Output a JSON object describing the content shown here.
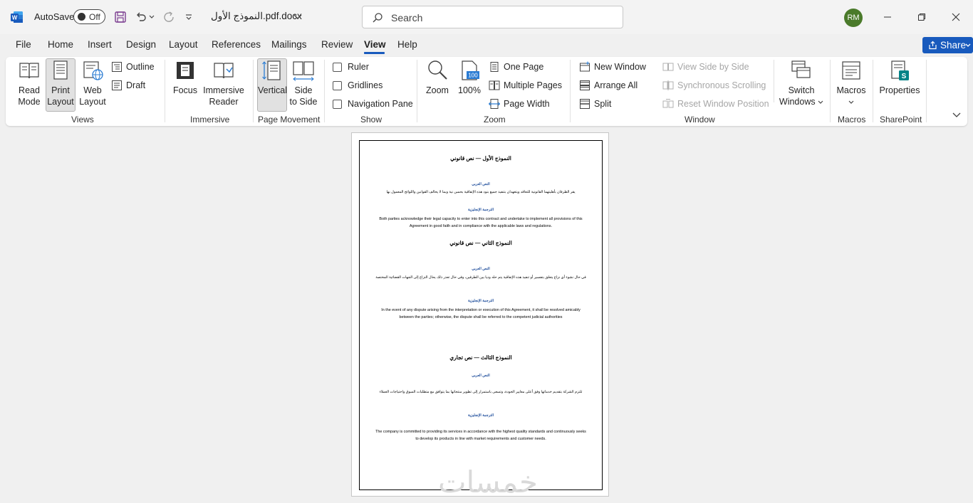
{
  "app": {
    "autosave_label": "AutoSave",
    "autosave_state": "Off",
    "doc_title": "النموذج الأول.pdf.docx",
    "search_placeholder": "Search",
    "user_initials": "RM",
    "accent": "#185abd"
  },
  "menu": {
    "tabs": [
      "File",
      "Home",
      "Insert",
      "Design",
      "Layout",
      "References",
      "Mailings",
      "Review",
      "View",
      "Help"
    ],
    "active_tab": "View",
    "share_label": "Share"
  },
  "ribbon": {
    "views": {
      "label": "Views",
      "read_mode": [
        "Read",
        "Mode"
      ],
      "print_layout": [
        "Print",
        "Layout"
      ],
      "web_layout": [
        "Web",
        "Layout"
      ],
      "outline": "Outline",
      "draft": "Draft"
    },
    "immersive": {
      "label": "Immersive",
      "focus": "Focus",
      "immersive_reader": [
        "Immersive",
        "Reader"
      ]
    },
    "page_movement": {
      "label": "Page Movement",
      "vertical": "Vertical",
      "side_to_side": [
        "Side",
        "to Side"
      ]
    },
    "show": {
      "label": "Show",
      "ruler": "Ruler",
      "gridlines": "Gridlines",
      "navigation_pane": "Navigation Pane"
    },
    "zoom": {
      "label": "Zoom",
      "zoom": "Zoom",
      "hundred": "100%",
      "hundred_icon_text": "100",
      "one_page": "One Page",
      "multiple_pages": "Multiple Pages",
      "page_width": "Page Width"
    },
    "window": {
      "label": "Window",
      "new_window": "New Window",
      "arrange_all": "Arrange All",
      "split": "Split",
      "view_side_by_side": "View Side by Side",
      "synchronous_scrolling": "Synchronous Scrolling",
      "reset_window_position": "Reset Window Position",
      "switch_windows": [
        "Switch",
        "Windows"
      ]
    },
    "macros": {
      "label": "Macros",
      "macros": "Macros"
    },
    "sharepoint": {
      "label": "SharePoint",
      "properties": "Properties"
    }
  },
  "document": {
    "s1_title": "النموذج الأول — نص قانوني",
    "s1_ar_head": "النص العربي",
    "s1_ar_text": "يقر الطرفان بأهليتهما القانونية للتعاقد ويتعهدان بتنفيذ جميع بنود هذه الإتفاقية بحسن نية وبما لا يخالف القوانين واللوائح المعمول بها",
    "s1_en_head": "الترجمة الإنجليزية",
    "s1_en_text": "Both parties acknowledge their legal capacity to enter into this contract and undertake to implement all provisions of this Agreement in good faith and in compliance with the applicable laws and regulations.",
    "s2_title": "النموذج الثاني — نص قانوني",
    "s2_ar_head": "النص العربي",
    "s2_ar_text": "في حال نشوء أي نزاع يتعلق بتفسير أو تنفيذ هذه الإتفاقية يتم حله وديا بين الطرفين، وفي حال تعذر ذلك يحال النزاع إلى الجهات القضائية المختصة",
    "s2_en_head": "الترجمة الإنجليزية",
    "s2_en_text": "In the event of any dispute arising from the interpretation or execution of this Agreement, it shall be resolved amicably between the parties; otherwise, the dispute shall be referred to the competent judicial authorities",
    "s3_title": "النموذج الثالث — نص تجاري",
    "s3_ar_head": "النص العربي",
    "s3_ar_text": "تلتزم الشركة بتقديم خدماتها وفق أعلى معايير الجودة، وتسعى باستمرار إلى تطوير منتجاتها بما يتوافق مع متطلبات السوق واحتياجات العملاء",
    "s3_en_head": "الترجمة الإنجليزية",
    "s3_en_text": "The company is committed to providing its services in accordance with the highest quality standards and continuously seeks to develop its products in line with market requirements and customer needs.",
    "watermark": "خمسات"
  }
}
